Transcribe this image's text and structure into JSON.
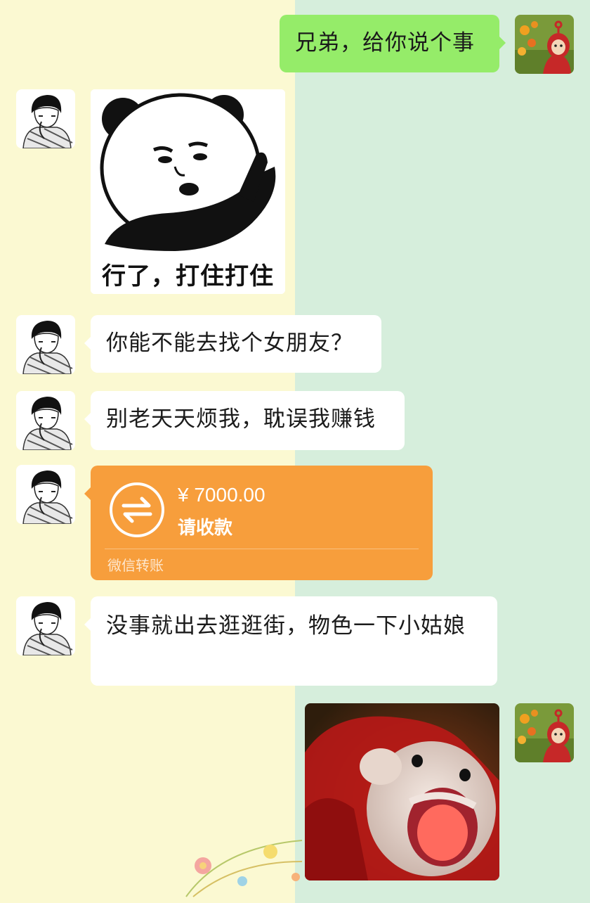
{
  "messages": {
    "m1_text": "兄弟，给你说个事",
    "m2_sticker_caption": "行了，打住打住",
    "m3_text": "你能不能去找个女朋友？",
    "m4_text": "别老天天烦我，耽误我赚钱",
    "m5_transfer": {
      "amount": "¥ 7000.00",
      "note": "请收款",
      "label": "微信转账"
    },
    "m6_text": "没事就出去逛逛街，物色一下小姑娘"
  },
  "icons": {
    "sender_avatar": "teletubby-avatar",
    "friend_avatar": "sketch-boy-avatar",
    "transfer": "transfer-arrows-icon"
  },
  "colors": {
    "left_background": "#fbf9d2",
    "right_background": "#d6eedc",
    "sent_bubble": "#95ec69",
    "received_bubble": "#ffffff",
    "transfer_card": "#f79e3c"
  }
}
